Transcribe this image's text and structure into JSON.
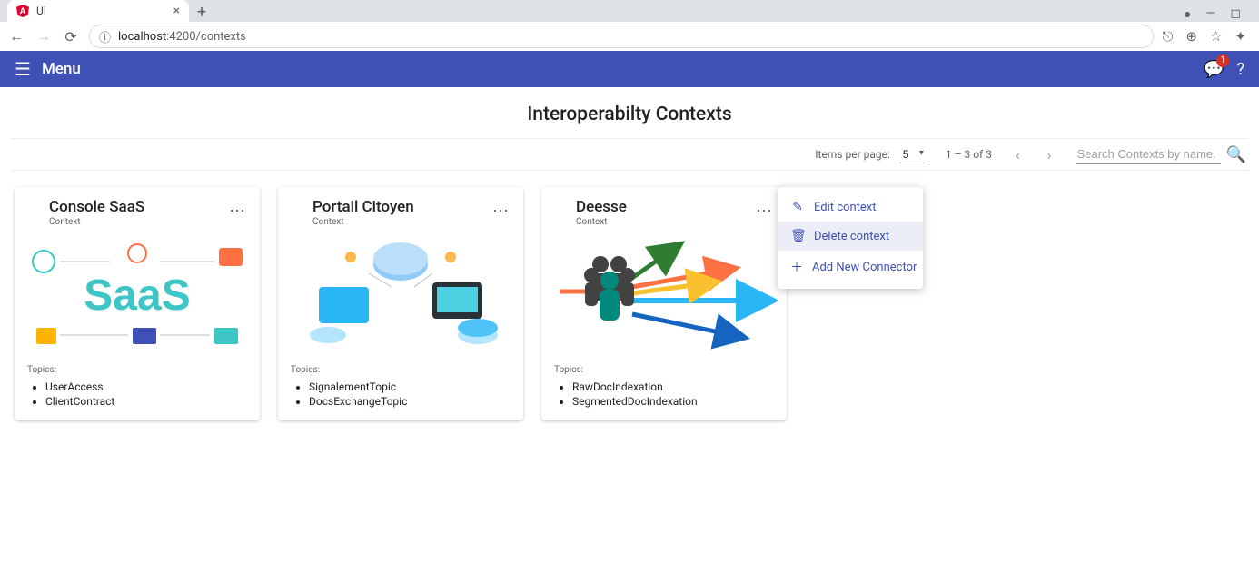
{
  "browser": {
    "tab_title": "UI",
    "url_host": "localhost",
    "url_path": ":4200/contexts"
  },
  "header": {
    "menu_label": "Menu",
    "notification_count": "1"
  },
  "page": {
    "title": "Interoperabilty Contexts",
    "items_per_page_label": "Items per page:",
    "items_per_page_value": "5",
    "range_label": "1 – 3 of 3",
    "search_placeholder": "Search Contexts by name.",
    "topics_label": "Topics:"
  },
  "cards": [
    {
      "title": "Console SaaS",
      "subtitle": "Context",
      "topics": [
        "UserAccess",
        "ClientContract"
      ]
    },
    {
      "title": "Portail Citoyen",
      "subtitle": "Context",
      "topics": [
        "SignalementTopic",
        "DocsExchangeTopic"
      ]
    },
    {
      "title": "Deesse",
      "subtitle": "Context",
      "topics": [
        "RawDocIndexation",
        "SegmentedDocIndexation"
      ]
    }
  ],
  "context_menu": {
    "edit": "Edit context",
    "delete": "Delete context",
    "add": "Add New Connector"
  }
}
